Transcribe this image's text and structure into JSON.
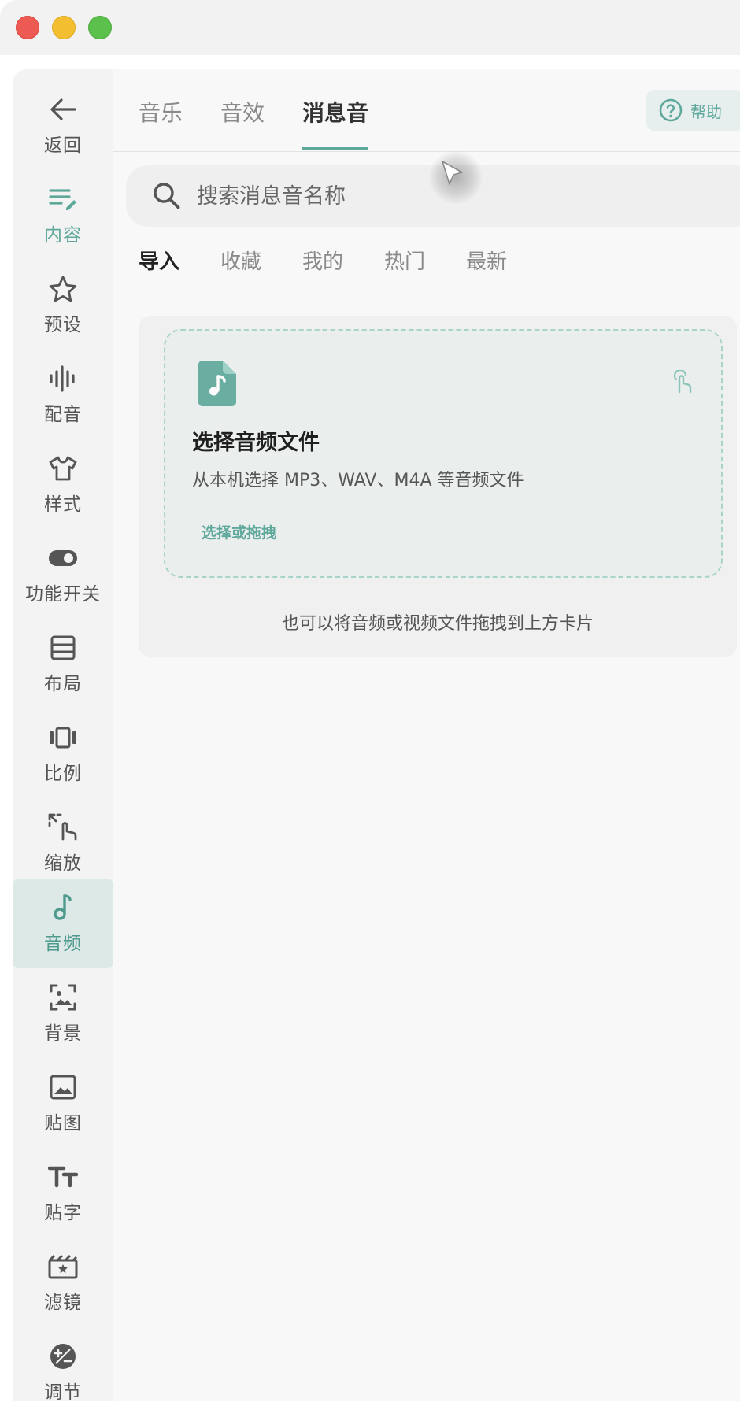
{
  "window": {
    "controls": [
      "close",
      "minimize",
      "zoom"
    ]
  },
  "sidebar": {
    "items": [
      {
        "label": "返回",
        "icon": "arrow-left-icon"
      },
      {
        "label": "内容",
        "icon": "edit-list-icon"
      },
      {
        "label": "预设",
        "icon": "star-icon"
      },
      {
        "label": "配音",
        "icon": "waveform-icon"
      },
      {
        "label": "样式",
        "icon": "shirt-icon"
      },
      {
        "label": "功能开关",
        "icon": "toggle-icon"
      },
      {
        "label": "布局",
        "icon": "layout-icon"
      },
      {
        "label": "比例",
        "icon": "ratio-icon"
      },
      {
        "label": "缩放",
        "icon": "zoom-gesture-icon"
      },
      {
        "label": "音频",
        "icon": "music-note-icon"
      },
      {
        "label": "背景",
        "icon": "background-image-icon"
      },
      {
        "label": "贴图",
        "icon": "image-icon"
      },
      {
        "label": "贴字",
        "icon": "text-icon"
      },
      {
        "label": "滤镜",
        "icon": "filter-icon"
      },
      {
        "label": "调节",
        "icon": "adjust-icon"
      }
    ]
  },
  "tabs": [
    {
      "label": "音乐"
    },
    {
      "label": "音效"
    },
    {
      "label": "消息音"
    }
  ],
  "help": {
    "label": "帮助"
  },
  "search": {
    "placeholder": "搜索消息音名称"
  },
  "subtabs": [
    {
      "label": "导入"
    },
    {
      "label": "收藏"
    },
    {
      "label": "我的"
    },
    {
      "label": "热门"
    },
    {
      "label": "最新"
    }
  ],
  "import_card": {
    "title": "选择音频文件",
    "description": "从本机选择 MP3、WAV、M4A 等音频文件",
    "action": "选择或拖拽",
    "hint": "也可以将音频或视频文件拖拽到上方卡片"
  },
  "colors": {
    "accent": "#5fa89c",
    "selected_bg": "#dde9e6"
  }
}
